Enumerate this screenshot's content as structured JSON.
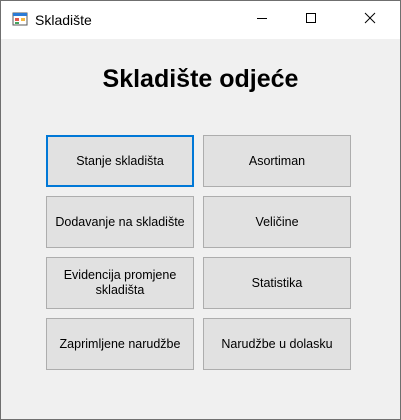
{
  "window": {
    "title": "Skladište",
    "icons": {
      "app": "app-window-icon",
      "minimize": "minimize-icon",
      "maximize": "maximize-icon",
      "close": "close-icon"
    }
  },
  "main": {
    "heading": "Skladište odjeće",
    "buttons": {
      "stanje": "Stanje skladišta",
      "asortiman": "Asortiman",
      "dodavanje": "Dodavanje na skladište",
      "velicine": "Veličine",
      "evidencija": "Evidencija promjene skladišta",
      "statistika": "Statistika",
      "zaprimljene": "Zaprimljene narudžbe",
      "narudzbe_dolazak": "Narudžbe u dolasku"
    },
    "focused_button": "stanje"
  }
}
